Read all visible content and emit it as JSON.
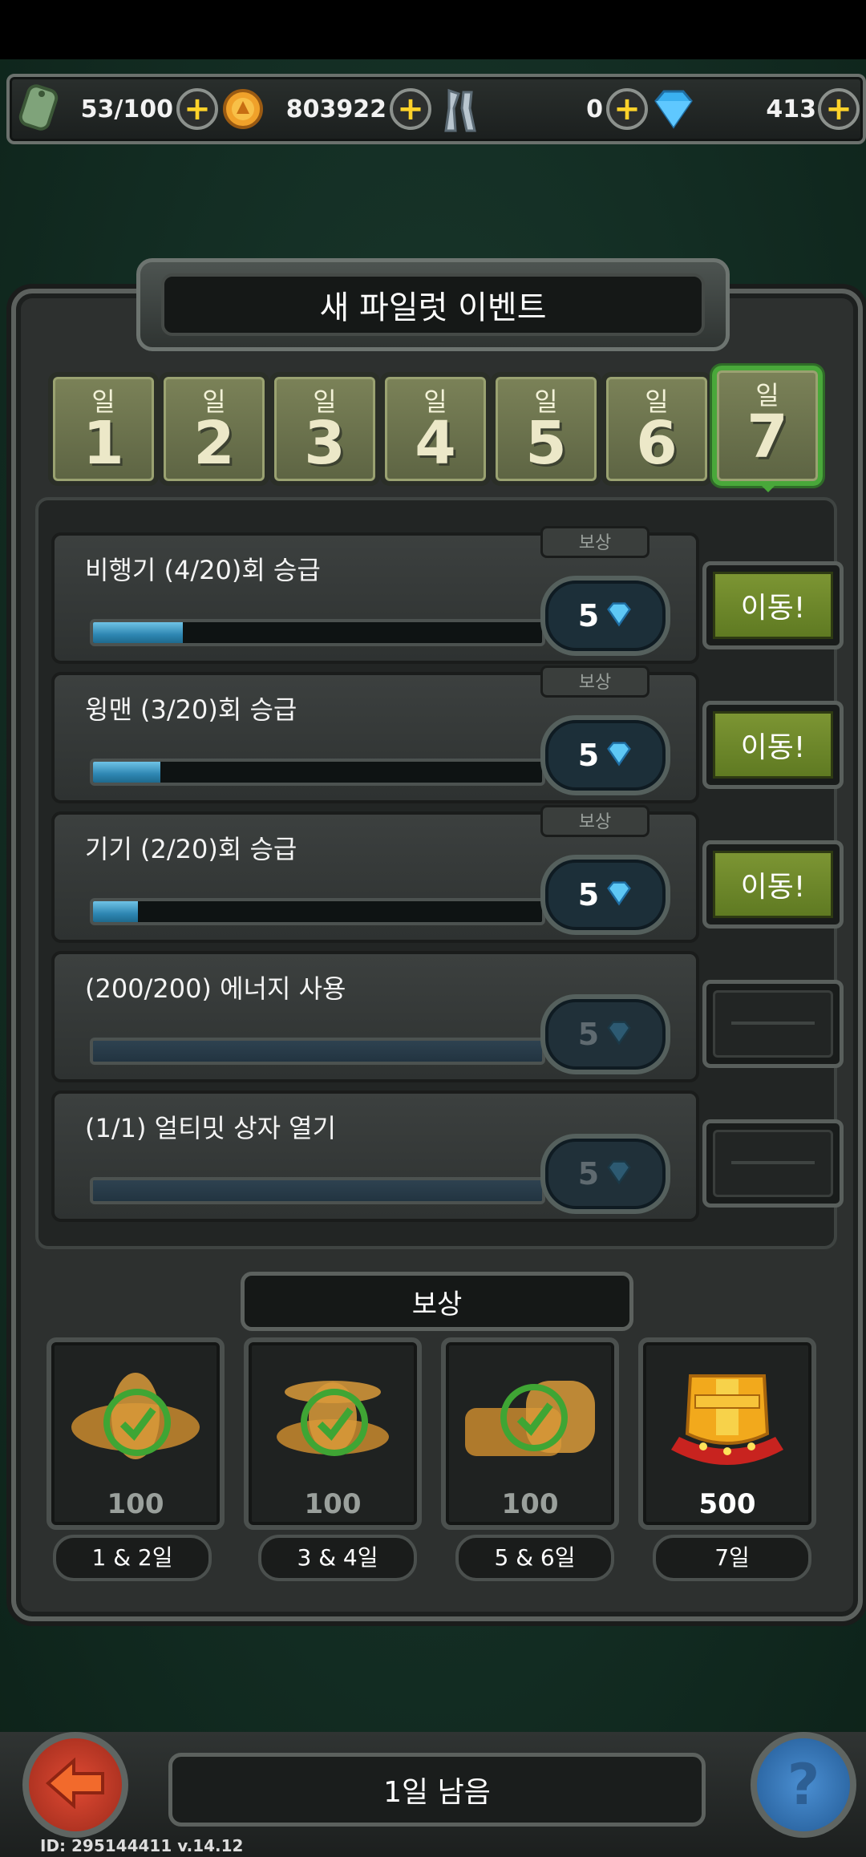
{
  "resources": {
    "energy": "53/100",
    "gold": "803922",
    "parts": "0",
    "gems": "413"
  },
  "title": "새 파일럿 이벤트",
  "day_tabs": [
    {
      "label": "일",
      "num": "1"
    },
    {
      "label": "일",
      "num": "2"
    },
    {
      "label": "일",
      "num": "3"
    },
    {
      "label": "일",
      "num": "4"
    },
    {
      "label": "일",
      "num": "5"
    },
    {
      "label": "일",
      "num": "6"
    },
    {
      "label": "일",
      "num": "7"
    }
  ],
  "tasks": [
    {
      "label": "비행기 (4/20)회 승급",
      "reward_tag": "보상",
      "reward": "5",
      "progress": 0.2,
      "button": "이동!"
    },
    {
      "label": "윙맨 (3/20)회 승급",
      "reward_tag": "보상",
      "reward": "5",
      "progress": 0.15,
      "button": "이동!"
    },
    {
      "label": "기기 (2/20)회 승급",
      "reward_tag": "보상",
      "reward": "5",
      "progress": 0.1,
      "button": "이동!"
    },
    {
      "label": "(200/200) 에너지 사용",
      "reward": "5",
      "progress": 1.0
    },
    {
      "label": "(1/1) 얼티밋 상자 열기",
      "reward": "5",
      "progress": 1.0
    }
  ],
  "rewards_title": "보상",
  "rewards": [
    {
      "amount": "100",
      "days": "1 & 2일"
    },
    {
      "amount": "100",
      "days": "3 & 4일"
    },
    {
      "amount": "100",
      "days": "5 & 6일"
    },
    {
      "amount": "500",
      "days": "7일"
    }
  ],
  "days_left": "1일 남음",
  "build_id": "ID: 295144411  v.14.12",
  "colors": {
    "accent_green": "#49a83a",
    "go_button": "#6f8a2a",
    "progress_blue": "#3a9bd0"
  }
}
